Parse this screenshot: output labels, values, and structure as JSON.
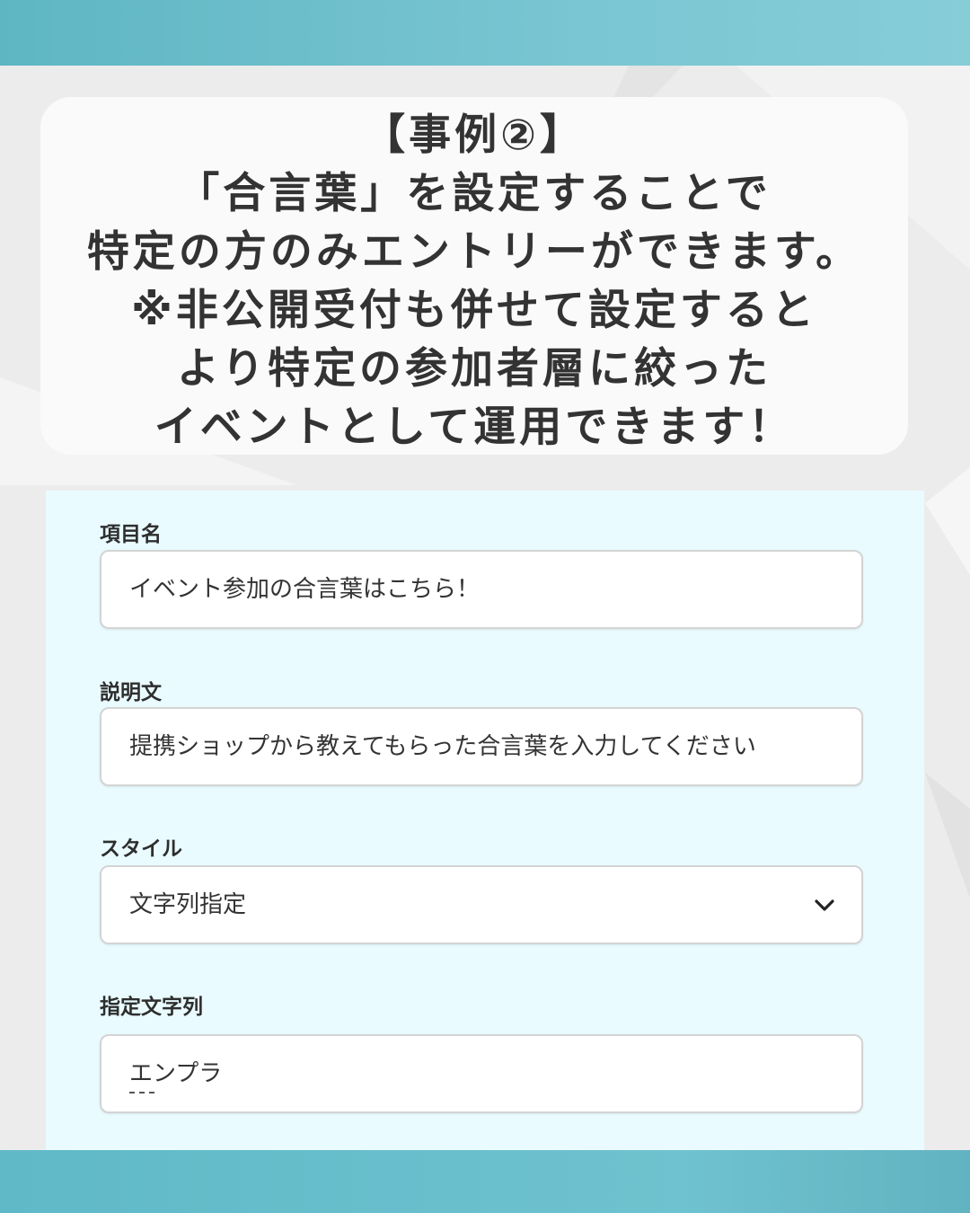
{
  "headline": {
    "lines": [
      "【事例②】",
      "「合言葉」を設定することで",
      "特定の方のみエントリーができます。",
      "※非公開受付も併せて設定すると",
      "より特定の参加者層に絞った",
      "イベントとして運用できます！"
    ]
  },
  "form": {
    "item_name": {
      "label": "項目名",
      "value": "イベント参加の合言葉はこちら！"
    },
    "description": {
      "label": "説明文",
      "value": "提携ショップから教えてもらった合言葉を入力してください"
    },
    "style": {
      "label": "スタイル",
      "value": "文字列指定",
      "icon": "chevron-down-icon"
    },
    "specified_string": {
      "label": "指定文字列",
      "value": "エンプラ"
    }
  },
  "colors": {
    "band": "#6fc2cf",
    "panel": "#e9fbff",
    "card": "#fafafa",
    "text": "#333333"
  }
}
